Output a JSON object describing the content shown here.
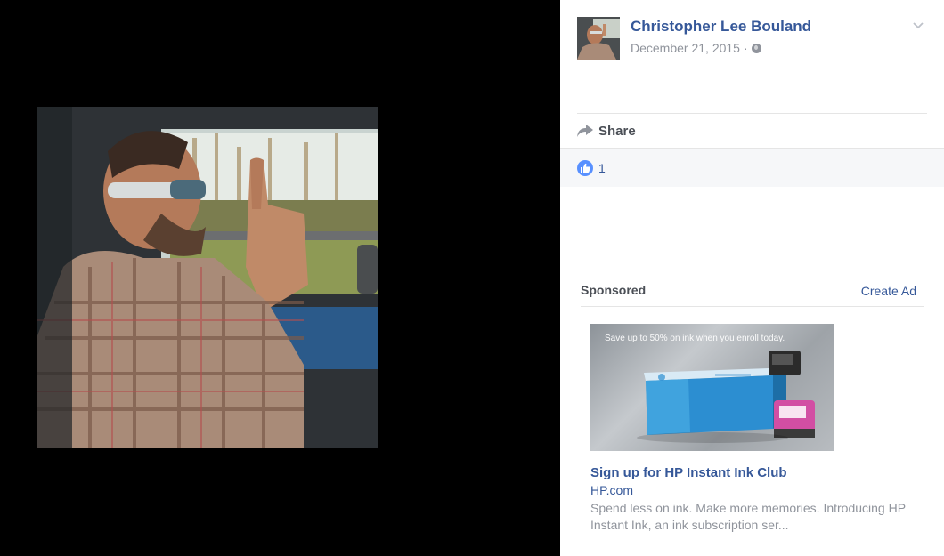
{
  "post": {
    "author": "Christopher Lee Bouland",
    "date": "December 21, 2015",
    "date_separator": "·",
    "privacy_icon": "globe-icon",
    "options_icon": "chevron-down-icon"
  },
  "actions": {
    "share_label": "Share",
    "share_icon": "share-arrow-icon"
  },
  "reactions": {
    "like_icon": "thumbs-up-icon",
    "like_count": "1"
  },
  "sidebar": {
    "sponsored_label": "Sponsored",
    "create_ad_label": "Create Ad"
  },
  "ad": {
    "image_text": "Save up to 50% on ink when you enroll today.",
    "title": "Sign up for HP Instant Ink Club",
    "domain": "HP.com",
    "description": "Spend less on ink. Make more memories. Introducing HP Instant Ink, an ink subscription ser..."
  },
  "colors": {
    "link_blue": "#365899",
    "meta_gray": "#90949c",
    "like_blue": "#5890ff",
    "viewer_bg": "#000000"
  }
}
